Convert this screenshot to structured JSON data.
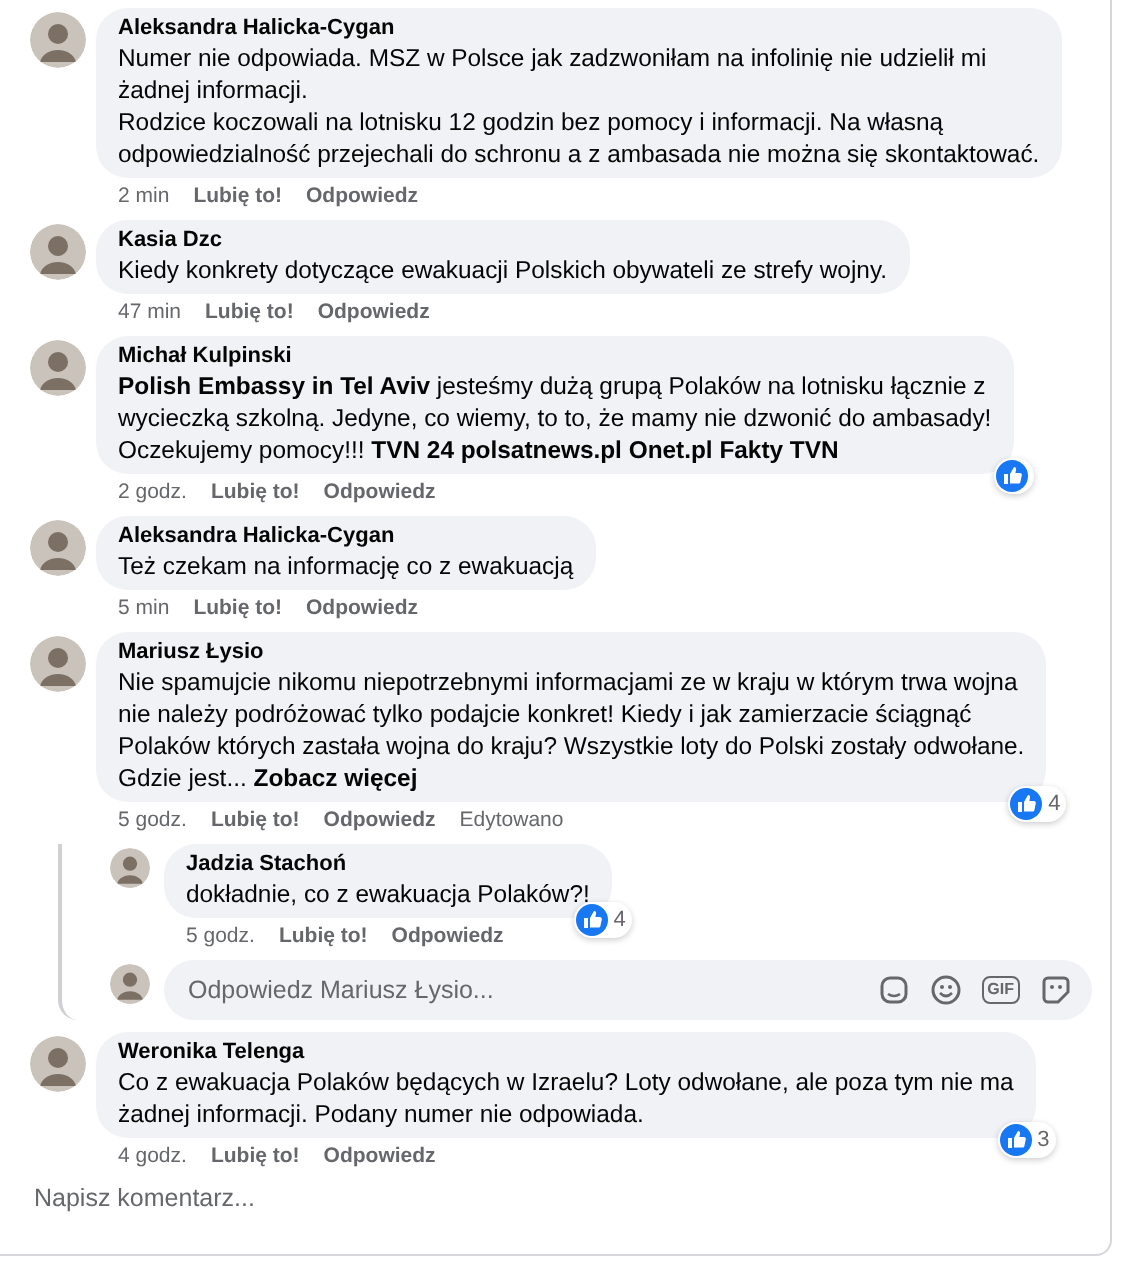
{
  "comments": [
    {
      "author": "Aleksandra Halicka-Cygan",
      "lines": [
        "Numer nie odpowiada. MSZ w Polsce jak zadzwoniłam na infolinię nie udzielił mi",
        "żadnej informacji.",
        "Rodzice koczowali na lotnisku 12 godzin bez pomocy i informacji. Na własną",
        "odpowiedzialność przejechali do schronu a z ambasada nie można się skontaktować."
      ],
      "time": "2 min",
      "like": "Lubię to!",
      "reply": "Odpowiedz"
    },
    {
      "author": "Kasia Dzc",
      "lines": [
        "Kiedy konkrety dotyczące ewakuacji Polskich obywateli ze strefy wojny."
      ],
      "time": "47 min",
      "like": "Lubię to!",
      "reply": "Odpowiedz"
    },
    {
      "author": "Michał Kulpinski",
      "lines": [
        "**Polish Embassy in Tel Aviv** jesteśmy dużą grupą Polaków na lotnisku łącznie z",
        "wycieczką szkolną. Jedyne, co wiemy, to to, że mamy nie dzwonić do ambasady!",
        "Oczekujemy pomocy!!! **TVN 24 polsatnews.pl Onet.pl Fakty TVN**"
      ],
      "time": "2 godz.",
      "like": "Lubię to!",
      "reply": "Odpowiedz",
      "reaction": {
        "kind": "like"
      }
    },
    {
      "author": "Aleksandra Halicka-Cygan",
      "lines": [
        "Też czekam na informację co z ewakuacją"
      ],
      "time": "5 min",
      "like": "Lubię to!",
      "reply": "Odpowiedz"
    },
    {
      "author": "Mariusz Łysio",
      "lines": [
        "Nie spamujcie nikomu niepotrzebnymi informacjami ze w kraju w którym trwa wojna",
        "nie należy podróżować tylko podajcie konkret! Kiedy i jak zamierzacie ściągnąć",
        "Polaków których zastała wojna do kraju? Wszystkie loty do Polski zostały odwołane.",
        "Gdzie jest..."
      ],
      "see_more": "Zobacz więcej",
      "time": "5 godz.",
      "like": "Lubię to!",
      "reply": "Odpowiedz",
      "edited": "Edytowano",
      "reaction": {
        "kind": "like",
        "count": "4"
      },
      "replies": [
        {
          "author": "Jadzia Stachoń",
          "lines": [
            "dokładnie, co z ewakuacja Polaków?!"
          ],
          "time": "5 godz.",
          "like": "Lubię to!",
          "reply": "Odpowiedz",
          "reaction": {
            "kind": "like",
            "count": "4"
          }
        }
      ],
      "reply_box": {
        "placeholder": "Odpowiedz Mariusz Łysio...",
        "tools": [
          {
            "kind": "sticker"
          },
          {
            "kind": "emoji"
          },
          {
            "kind": "gif",
            "label": "GIF"
          },
          {
            "kind": "smiley-sticker"
          }
        ]
      }
    },
    {
      "author": "Weronika Telenga",
      "lines": [
        "Co z ewakuacja Polaków będących w Izraelu? Loty odwołane, ale poza tym nie ma",
        "żadnej informacji. Podany numer nie odpowiada."
      ],
      "time": "4 godz.",
      "like": "Lubię to!",
      "reply": "Odpowiedz",
      "reaction": {
        "kind": "like",
        "count": "3"
      }
    }
  ],
  "comment_box": {
    "placeholder": "Napisz komentarz..."
  }
}
